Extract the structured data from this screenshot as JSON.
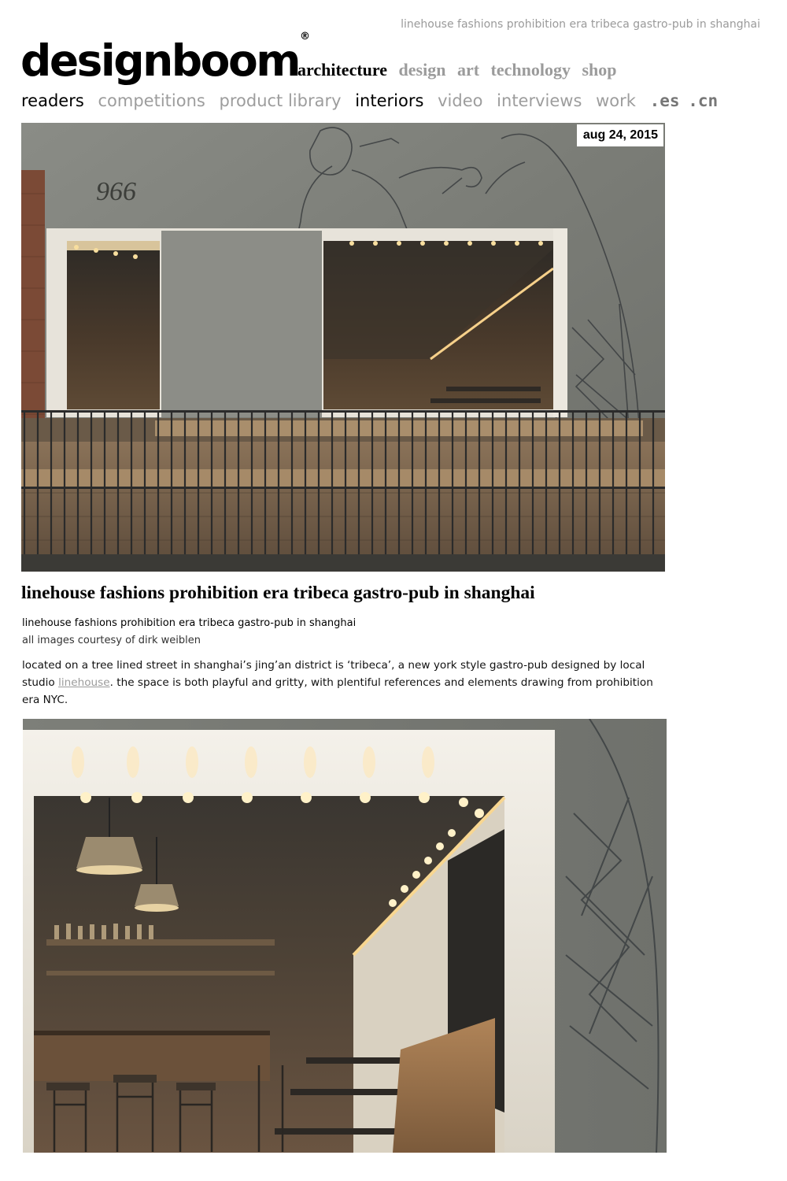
{
  "header": {
    "page_title": "linehouse fashions prohibition era tribeca gastro-pub in shanghai",
    "logo_text": "designboom",
    "logo_mark": "®"
  },
  "main_nav": [
    "architecture",
    "design",
    "art",
    "technology",
    "shop"
  ],
  "sub_nav": [
    "readers",
    "competitions",
    "product library",
    "interiors",
    "video",
    "interviews",
    "work"
  ],
  "lang_nav": [
    ".es",
    ".cn"
  ],
  "article": {
    "date": "aug 24, 2015",
    "hero_wall_number": "966",
    "title": "linehouse fashions prohibition era tribeca gastro-pub in shanghai",
    "caption": "linehouse fashions prohibition era tribeca gastro-pub in shanghai",
    "credit": "all images courtesy of dirk weiblen",
    "body_before": "located on a tree lined street in shanghai’s jing’an district is ‘tribeca’, a new york style gastro-pub designed by local studio ",
    "body_link": "linehouse",
    "body_after": ". the space is both playful and gritty, with plentiful references and elements drawing from prohibition era NYC."
  },
  "colors": {
    "nav_inactive": "#9b9b9b",
    "nav_active": "#000000",
    "concrete": "#7e817b",
    "warm_light": "#f3c57a"
  }
}
